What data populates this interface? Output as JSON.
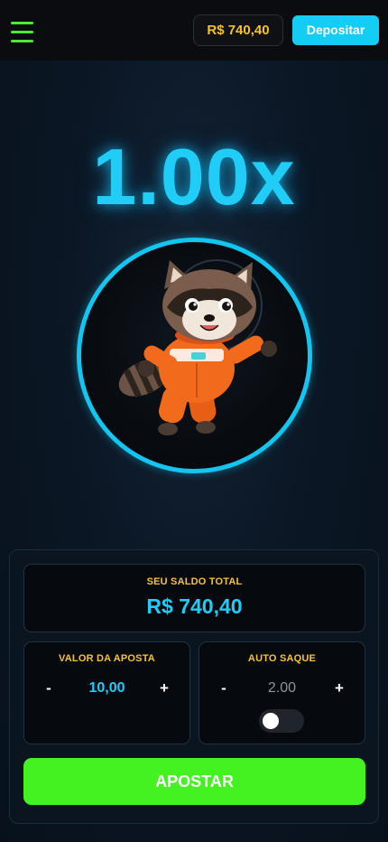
{
  "header": {
    "balance": "R$ 740,40",
    "deposit_label": "Depositar"
  },
  "game": {
    "multiplier": "1.00x"
  },
  "saldo": {
    "title": "SEU SALDO TOTAL",
    "value": "R$ 740,40"
  },
  "bet": {
    "title": "VALOR DA APOSTA",
    "minus": "-",
    "value": "10,00",
    "plus": "+"
  },
  "auto_cashout": {
    "title": "AUTO SAQUE",
    "minus": "-",
    "value": "2.00",
    "plus": "+",
    "enabled": false
  },
  "action": {
    "label": "APOSTAR"
  },
  "colors": {
    "accent_cyan": "#1fcdf7",
    "accent_green": "#45f221",
    "label_gold": "#f5c23a",
    "balance_gold": "#f5c518"
  },
  "icons": {
    "menu": "hamburger-menu-icon",
    "mascot": "raccoon-astronaut-mascot"
  }
}
